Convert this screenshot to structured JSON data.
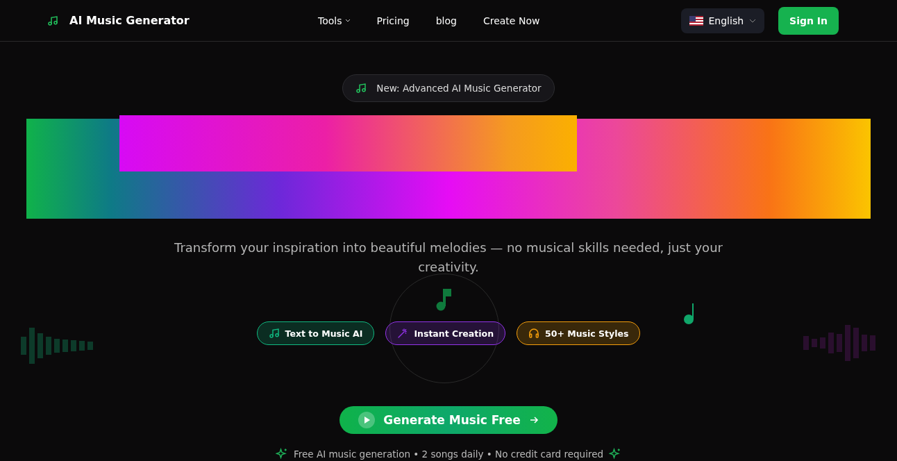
{
  "header": {
    "brand": "AI Music Generator",
    "nav": [
      {
        "label": "Tools",
        "dropdown": true
      },
      {
        "label": "Pricing",
        "dropdown": false
      },
      {
        "label": "blog",
        "dropdown": false
      },
      {
        "label": "Create Now",
        "dropdown": false
      }
    ],
    "language": "English",
    "sign_in": "Sign In"
  },
  "hero": {
    "announcement": "New: Advanced AI Music Generator",
    "subtitle": "Transform your inspiration into beautiful melodies — no musical skills needed, just your creativity.",
    "features": [
      {
        "kind": "notes",
        "label": "Text to Music AI",
        "color": "#10b981"
      },
      {
        "kind": "wand",
        "label": "Instant Creation",
        "color": "#9333ea"
      },
      {
        "kind": "headphones",
        "label": "50+ Music Styles",
        "color": "#f59e0b"
      }
    ],
    "cta": "Generate Music Free",
    "footnote": "Free AI music generation • 2 songs daily • No credit card required"
  }
}
